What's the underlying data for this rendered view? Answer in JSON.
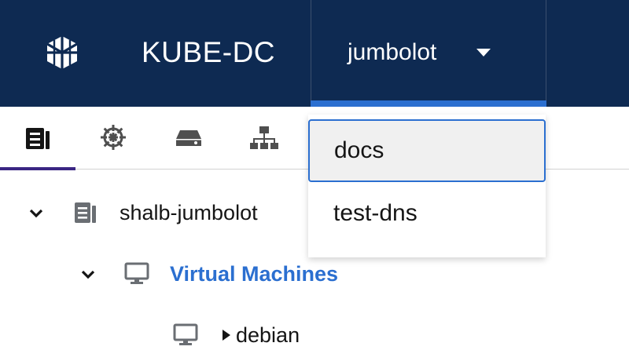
{
  "header": {
    "logo_icon": "cube-logo-icon",
    "brand": "KUBE-DC",
    "project_selector": {
      "selected": "jumbolot",
      "icon": "caret-down-icon",
      "options": [
        "docs",
        "test-dns"
      ]
    },
    "colors": {
      "background": "#0e2a52",
      "accent": "#2b6fd0"
    }
  },
  "tabs": [
    {
      "icon": "server-rack-icon",
      "active": true
    },
    {
      "icon": "helm-wheel-icon",
      "active": false
    },
    {
      "icon": "hard-drive-icon",
      "active": false
    },
    {
      "icon": "network-topology-icon",
      "active": false
    }
  ],
  "tree": {
    "root": {
      "label": "shalb-jumbolot",
      "icon": "server-rack-icon",
      "expanded": true
    },
    "group": {
      "label": "Virtual Machines",
      "icon": "monitor-icon",
      "expanded": true
    },
    "items": [
      {
        "label": "debian",
        "icon": "monitor-icon",
        "expanded": false
      }
    ]
  }
}
